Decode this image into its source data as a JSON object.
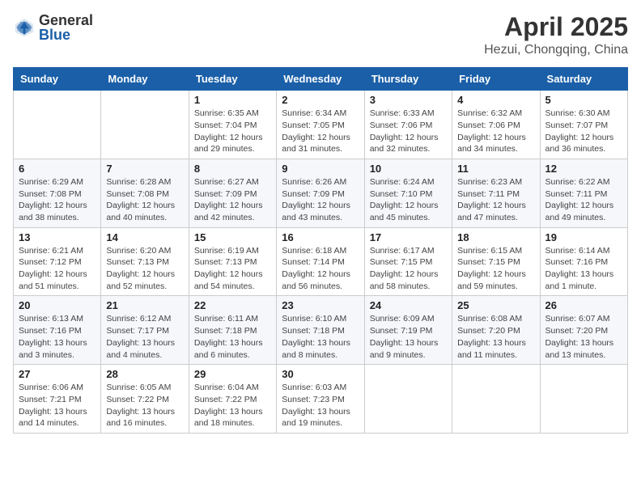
{
  "logo": {
    "general": "General",
    "blue": "Blue"
  },
  "title": {
    "month": "April 2025",
    "location": "Hezui, Chongqing, China"
  },
  "weekdays": [
    "Sunday",
    "Monday",
    "Tuesday",
    "Wednesday",
    "Thursday",
    "Friday",
    "Saturday"
  ],
  "weeks": [
    [
      {
        "day": null
      },
      {
        "day": null
      },
      {
        "day": "1",
        "sunrise": "Sunrise: 6:35 AM",
        "sunset": "Sunset: 7:04 PM",
        "daylight": "Daylight: 12 hours and 29 minutes."
      },
      {
        "day": "2",
        "sunrise": "Sunrise: 6:34 AM",
        "sunset": "Sunset: 7:05 PM",
        "daylight": "Daylight: 12 hours and 31 minutes."
      },
      {
        "day": "3",
        "sunrise": "Sunrise: 6:33 AM",
        "sunset": "Sunset: 7:06 PM",
        "daylight": "Daylight: 12 hours and 32 minutes."
      },
      {
        "day": "4",
        "sunrise": "Sunrise: 6:32 AM",
        "sunset": "Sunset: 7:06 PM",
        "daylight": "Daylight: 12 hours and 34 minutes."
      },
      {
        "day": "5",
        "sunrise": "Sunrise: 6:30 AM",
        "sunset": "Sunset: 7:07 PM",
        "daylight": "Daylight: 12 hours and 36 minutes."
      }
    ],
    [
      {
        "day": "6",
        "sunrise": "Sunrise: 6:29 AM",
        "sunset": "Sunset: 7:08 PM",
        "daylight": "Daylight: 12 hours and 38 minutes."
      },
      {
        "day": "7",
        "sunrise": "Sunrise: 6:28 AM",
        "sunset": "Sunset: 7:08 PM",
        "daylight": "Daylight: 12 hours and 40 minutes."
      },
      {
        "day": "8",
        "sunrise": "Sunrise: 6:27 AM",
        "sunset": "Sunset: 7:09 PM",
        "daylight": "Daylight: 12 hours and 42 minutes."
      },
      {
        "day": "9",
        "sunrise": "Sunrise: 6:26 AM",
        "sunset": "Sunset: 7:09 PM",
        "daylight": "Daylight: 12 hours and 43 minutes."
      },
      {
        "day": "10",
        "sunrise": "Sunrise: 6:24 AM",
        "sunset": "Sunset: 7:10 PM",
        "daylight": "Daylight: 12 hours and 45 minutes."
      },
      {
        "day": "11",
        "sunrise": "Sunrise: 6:23 AM",
        "sunset": "Sunset: 7:11 PM",
        "daylight": "Daylight: 12 hours and 47 minutes."
      },
      {
        "day": "12",
        "sunrise": "Sunrise: 6:22 AM",
        "sunset": "Sunset: 7:11 PM",
        "daylight": "Daylight: 12 hours and 49 minutes."
      }
    ],
    [
      {
        "day": "13",
        "sunrise": "Sunrise: 6:21 AM",
        "sunset": "Sunset: 7:12 PM",
        "daylight": "Daylight: 12 hours and 51 minutes."
      },
      {
        "day": "14",
        "sunrise": "Sunrise: 6:20 AM",
        "sunset": "Sunset: 7:13 PM",
        "daylight": "Daylight: 12 hours and 52 minutes."
      },
      {
        "day": "15",
        "sunrise": "Sunrise: 6:19 AM",
        "sunset": "Sunset: 7:13 PM",
        "daylight": "Daylight: 12 hours and 54 minutes."
      },
      {
        "day": "16",
        "sunrise": "Sunrise: 6:18 AM",
        "sunset": "Sunset: 7:14 PM",
        "daylight": "Daylight: 12 hours and 56 minutes."
      },
      {
        "day": "17",
        "sunrise": "Sunrise: 6:17 AM",
        "sunset": "Sunset: 7:15 PM",
        "daylight": "Daylight: 12 hours and 58 minutes."
      },
      {
        "day": "18",
        "sunrise": "Sunrise: 6:15 AM",
        "sunset": "Sunset: 7:15 PM",
        "daylight": "Daylight: 12 hours and 59 minutes."
      },
      {
        "day": "19",
        "sunrise": "Sunrise: 6:14 AM",
        "sunset": "Sunset: 7:16 PM",
        "daylight": "Daylight: 13 hours and 1 minute."
      }
    ],
    [
      {
        "day": "20",
        "sunrise": "Sunrise: 6:13 AM",
        "sunset": "Sunset: 7:16 PM",
        "daylight": "Daylight: 13 hours and 3 minutes."
      },
      {
        "day": "21",
        "sunrise": "Sunrise: 6:12 AM",
        "sunset": "Sunset: 7:17 PM",
        "daylight": "Daylight: 13 hours and 4 minutes."
      },
      {
        "day": "22",
        "sunrise": "Sunrise: 6:11 AM",
        "sunset": "Sunset: 7:18 PM",
        "daylight": "Daylight: 13 hours and 6 minutes."
      },
      {
        "day": "23",
        "sunrise": "Sunrise: 6:10 AM",
        "sunset": "Sunset: 7:18 PM",
        "daylight": "Daylight: 13 hours and 8 minutes."
      },
      {
        "day": "24",
        "sunrise": "Sunrise: 6:09 AM",
        "sunset": "Sunset: 7:19 PM",
        "daylight": "Daylight: 13 hours and 9 minutes."
      },
      {
        "day": "25",
        "sunrise": "Sunrise: 6:08 AM",
        "sunset": "Sunset: 7:20 PM",
        "daylight": "Daylight: 13 hours and 11 minutes."
      },
      {
        "day": "26",
        "sunrise": "Sunrise: 6:07 AM",
        "sunset": "Sunset: 7:20 PM",
        "daylight": "Daylight: 13 hours and 13 minutes."
      }
    ],
    [
      {
        "day": "27",
        "sunrise": "Sunrise: 6:06 AM",
        "sunset": "Sunset: 7:21 PM",
        "daylight": "Daylight: 13 hours and 14 minutes."
      },
      {
        "day": "28",
        "sunrise": "Sunrise: 6:05 AM",
        "sunset": "Sunset: 7:22 PM",
        "daylight": "Daylight: 13 hours and 16 minutes."
      },
      {
        "day": "29",
        "sunrise": "Sunrise: 6:04 AM",
        "sunset": "Sunset: 7:22 PM",
        "daylight": "Daylight: 13 hours and 18 minutes."
      },
      {
        "day": "30",
        "sunrise": "Sunrise: 6:03 AM",
        "sunset": "Sunset: 7:23 PM",
        "daylight": "Daylight: 13 hours and 19 minutes."
      },
      {
        "day": null
      },
      {
        "day": null
      },
      {
        "day": null
      }
    ]
  ]
}
